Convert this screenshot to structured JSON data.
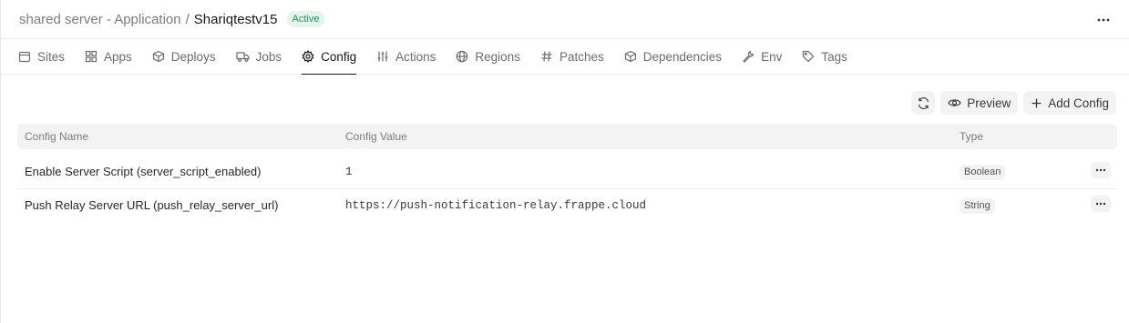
{
  "header": {
    "parent": "shared server - Application",
    "separator": "/",
    "current": "Shariqtestv15",
    "status": "Active"
  },
  "tabs": [
    {
      "label": "Sites",
      "icon": "calendar-icon"
    },
    {
      "label": "Apps",
      "icon": "grid-icon"
    },
    {
      "label": "Deploys",
      "icon": "package-icon"
    },
    {
      "label": "Jobs",
      "icon": "truck-icon"
    },
    {
      "label": "Config",
      "icon": "gear-icon",
      "active": true
    },
    {
      "label": "Actions",
      "icon": "sliders-icon"
    },
    {
      "label": "Regions",
      "icon": "globe-icon"
    },
    {
      "label": "Patches",
      "icon": "hash-icon"
    },
    {
      "label": "Dependencies",
      "icon": "box-icon"
    },
    {
      "label": "Env",
      "icon": "wrench-icon"
    },
    {
      "label": "Tags",
      "icon": "tag-icon"
    }
  ],
  "toolbar": {
    "refresh_icon": "refresh-icon",
    "preview_label": "Preview",
    "add_label": "Add Config"
  },
  "table": {
    "columns": [
      "Config Name",
      "Config Value",
      "Type"
    ],
    "rows": [
      {
        "name": "Enable Server Script (server_script_enabled)",
        "value": "1",
        "type": "Boolean"
      },
      {
        "name": "Push Relay Server URL (push_relay_server_url)",
        "value": "https://push-notification-relay.frappe.cloud",
        "type": "String"
      }
    ]
  },
  "colors": {
    "active_badge_bg": "#e4f5e9",
    "active_badge_text": "#278f5e",
    "button_bg": "#f3f3f3"
  }
}
